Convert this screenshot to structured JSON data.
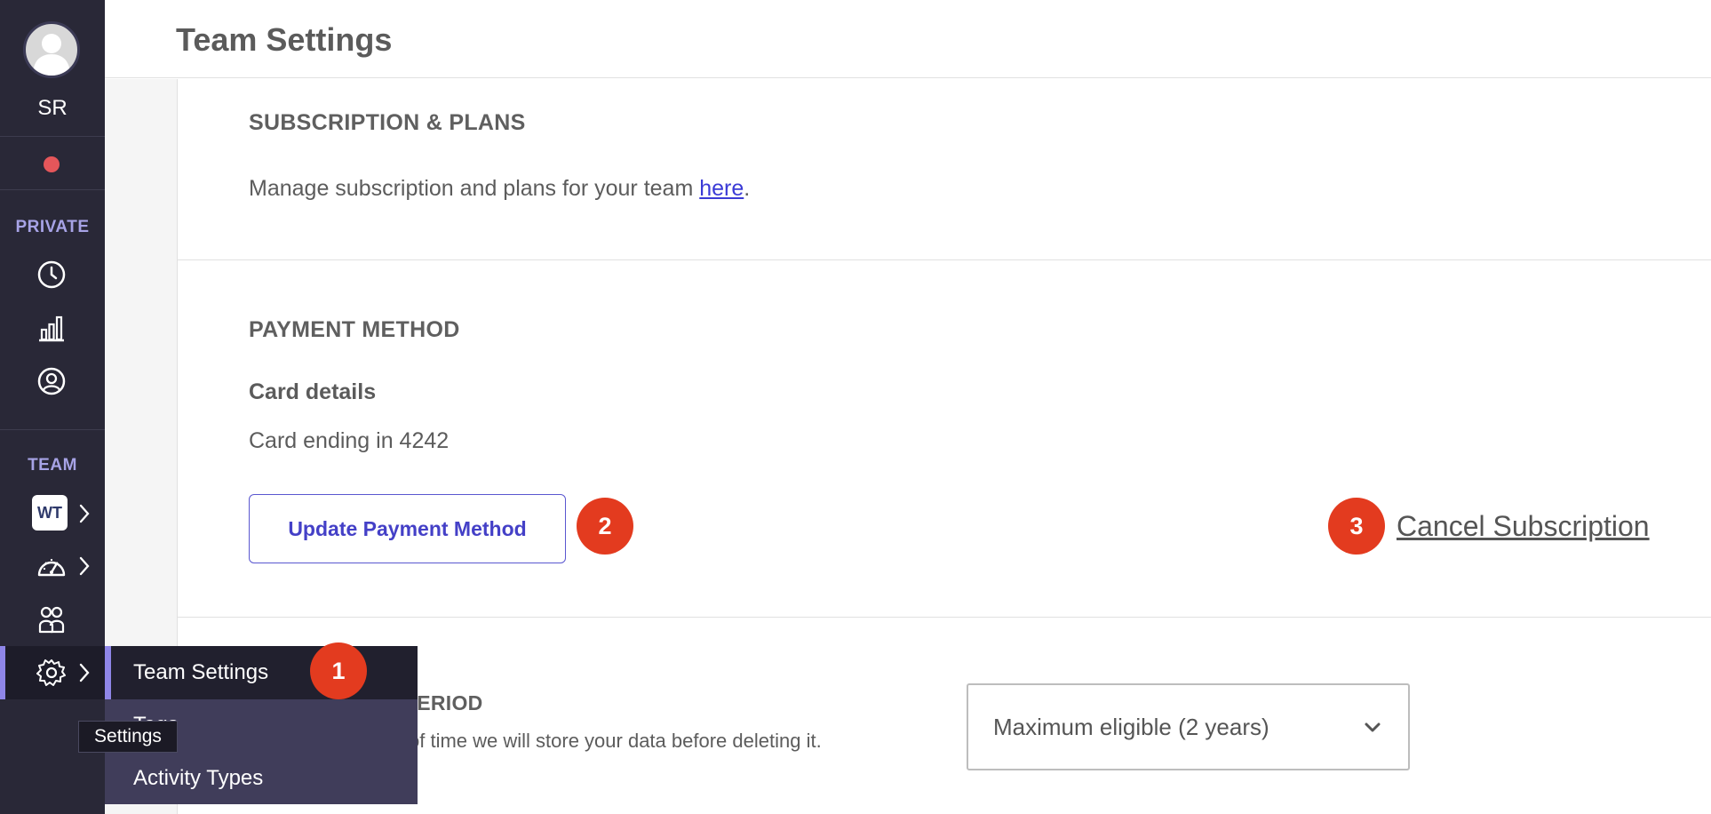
{
  "sidebar": {
    "user_initials": "SR",
    "private_label": "PRIVATE",
    "team_label": "TEAM",
    "team_badge": "WT",
    "tooltip": "Settings",
    "status_color": "#e5565a",
    "icons": [
      "clock-icon",
      "bar-chart-icon",
      "profile-icon",
      "speedometer-icon",
      "people-icon",
      "gear-icon"
    ]
  },
  "flyout": {
    "items": [
      {
        "label": "Team Settings"
      },
      {
        "label": "Tags"
      },
      {
        "label": "Activity Types"
      }
    ]
  },
  "header": {
    "title": "Team Settings"
  },
  "subscription": {
    "heading": "SUBSCRIPTION & PLANS",
    "text_before": "Manage subscription and plans for your team ",
    "link_text": "here",
    "text_after": "."
  },
  "payment": {
    "heading": "PAYMENT METHOD",
    "card_label": "Card details",
    "card_text": "Card ending in 4242",
    "update_button": "Update Payment Method",
    "cancel_link": "Cancel Subscription"
  },
  "retention": {
    "heading_visible": "N PERIOD",
    "description_visible": "of time we will store your data before deleting it.",
    "select_value": "Maximum eligible (2 years)"
  },
  "annotations": {
    "badge_1": "1",
    "badge_2": "2",
    "badge_3": "3"
  },
  "colors": {
    "sidebar_bg": "#292837",
    "accent": "#8f86e8",
    "link": "#3b3bd6",
    "badge": "#e33b1f"
  }
}
